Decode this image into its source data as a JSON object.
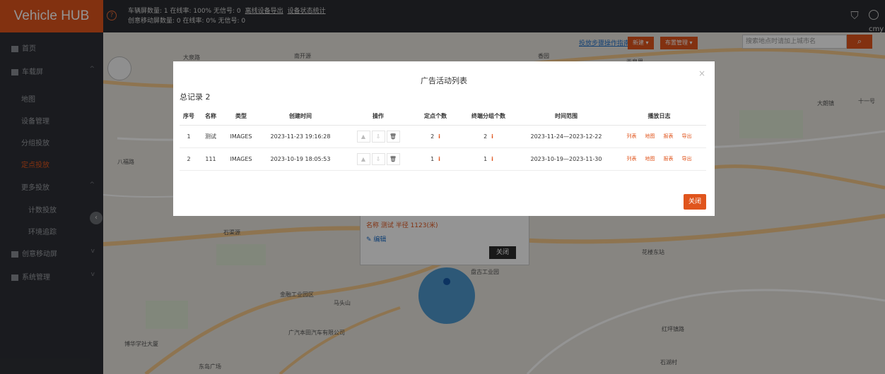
{
  "app": {
    "title": "Vehicle HUB",
    "help_icon": "?"
  },
  "header": {
    "stats_line1": "车辆屏数量: 1  在线率: 100%  无信号: 0",
    "link1": "离线设备导出",
    "link2": "设备状态统计",
    "stats_line2": "创意移动屏数量: 0  在线率: 0%  无信号: 0",
    "user": "cmy ▾"
  },
  "sidebar": {
    "items": [
      {
        "label": "首页"
      },
      {
        "label": "车载屏",
        "chevron": "^"
      },
      {
        "label": "地图"
      },
      {
        "label": "设备管理"
      },
      {
        "label": "分组投放"
      },
      {
        "label": "定点投放"
      },
      {
        "label": "更多投放",
        "chevron": "^"
      },
      {
        "label": "计数投放"
      },
      {
        "label": "环境追踪"
      },
      {
        "label": "创意移动屏",
        "chevron": "v"
      },
      {
        "label": "系统管理",
        "chevron": "v"
      }
    ],
    "collapse_icon": "‹"
  },
  "map": {
    "top_link": "投放步骤操作指南",
    "btn_new": "新建 ▾",
    "btn_manage": "布置管理 ▾",
    "search_placeholder": "搜索地点时请加上城市名",
    "search_icon": "⌕",
    "labels": [
      "大泉路",
      "南开源",
      "香园",
      "天泉里",
      "八福路",
      "石渠源",
      "大朗镇",
      "花楼东站",
      "金融工业园区",
      "马头山",
      "红坪镇路",
      "广汽本田汽车有限公司",
      "东岛广场",
      "石湖村",
      "博华学社大厦",
      "盘古工业园",
      "十一号"
    ],
    "popup": {
      "line1": "名称 测试  半径 1123(米)",
      "edit": "编辑",
      "close": "关闭"
    }
  },
  "modal": {
    "title": "广告活动列表",
    "close_x": "×",
    "total": "总记录 2",
    "columns": [
      "序号",
      "名称",
      "类型",
      "创建时间",
      "操作",
      "定点个数",
      "终端分组个数",
      "时间范围",
      "播放日志"
    ],
    "rows": [
      {
        "no": "1",
        "name": "测试",
        "type": "IMAGES",
        "created": "2023-11-23 19:16:28",
        "points": "2",
        "groups": "2",
        "range": "2023-11-24—2023-12-22",
        "logs": [
          "列表",
          "地图",
          "报表",
          "导出"
        ]
      },
      {
        "no": "2",
        "name": "111",
        "type": "IMAGES",
        "created": "2023-10-19 18:05:53",
        "points": "1",
        "groups": "1",
        "range": "2023-10-19—2023-11-30",
        "logs": [
          "列表",
          "地图",
          "报表",
          "导出"
        ]
      }
    ],
    "ops_icons": [
      "▲",
      "⇩",
      "🗑"
    ],
    "info_icon": "i",
    "close_btn": "关闭"
  }
}
